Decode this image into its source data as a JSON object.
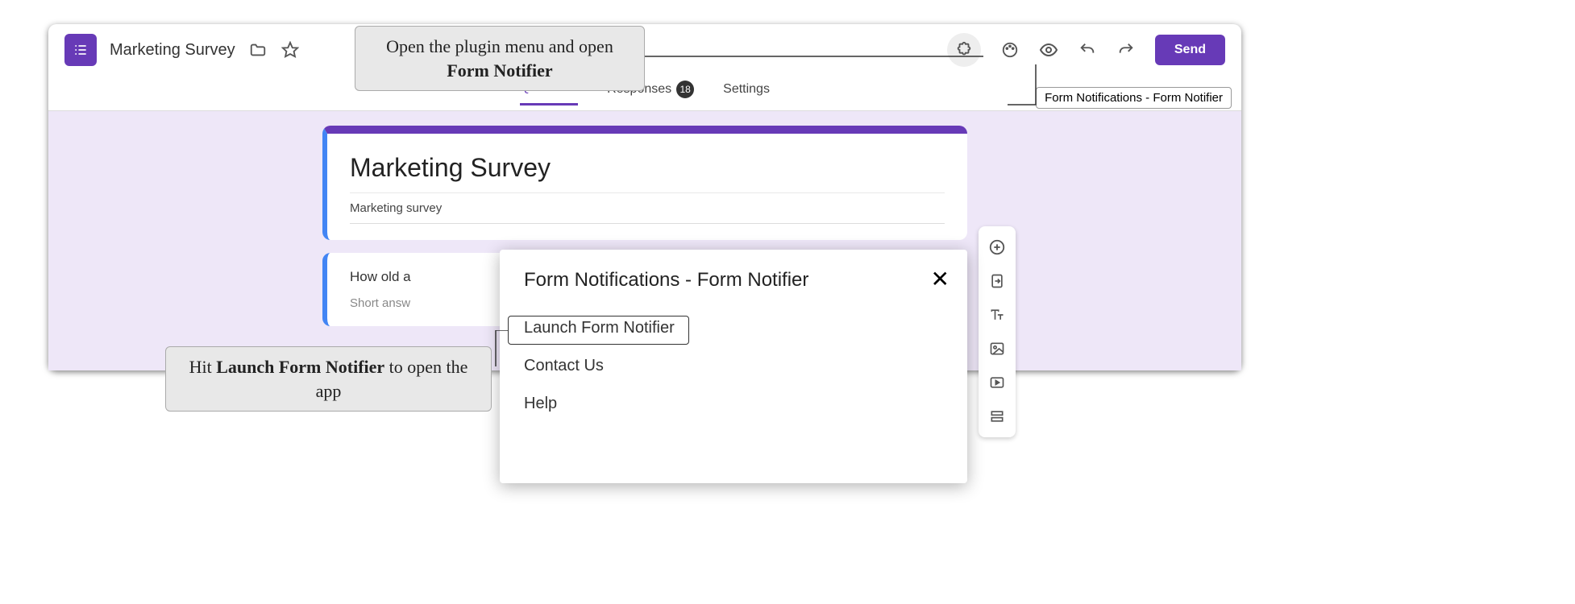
{
  "doc": {
    "title": "Marketing Survey"
  },
  "header": {
    "send_label": "Send",
    "addon_tooltip": "Form Notifications - Form Notifier"
  },
  "tabs": {
    "questions": "Questions",
    "responses": "Responses",
    "responses_count": "18",
    "settings": "Settings"
  },
  "form": {
    "title": "Marketing Survey",
    "description": "Marketing survey",
    "q1_text": "How old a",
    "q1_hint": "Short answ"
  },
  "plugin_popup": {
    "title": "Form Notifications - Form Notifier",
    "items": {
      "launch": "Launch Form Notifier",
      "contact": "Contact Us",
      "help": "Help"
    }
  },
  "callouts": {
    "c1_pre": "Open the plugin menu and open ",
    "c1_bold": "Form Notifier",
    "c2_pre": "Hit ",
    "c2_bold": "Launch Form Notifier",
    "c2_post": " to open the app"
  }
}
